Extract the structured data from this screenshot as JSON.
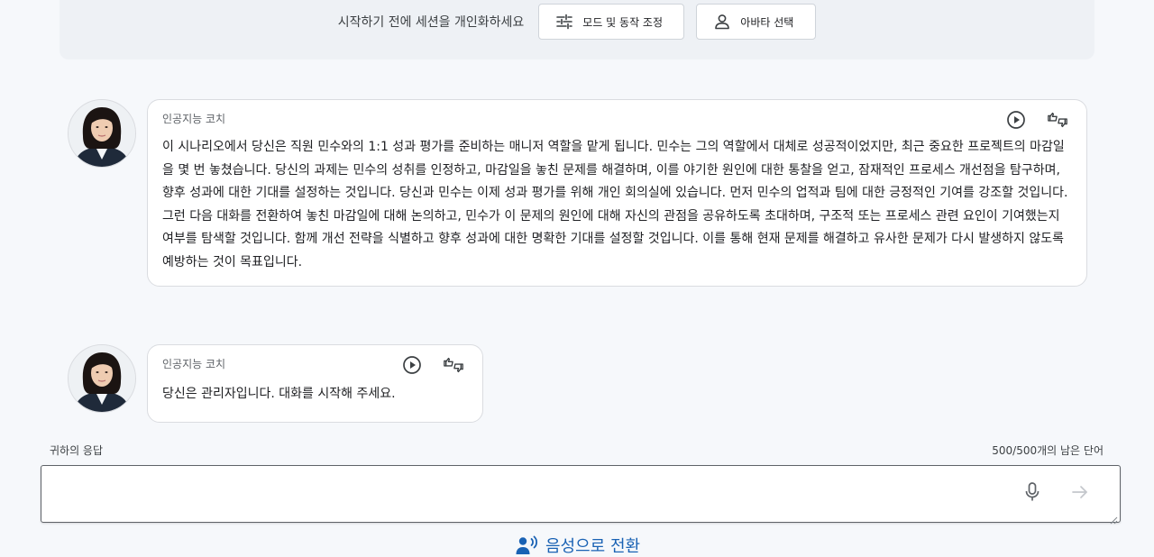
{
  "personalize": {
    "prompt": "시작하기 전에 세션을 개인화하세요",
    "mode_button": "모드 및 동작 조정",
    "avatar_button": "아바타 선택"
  },
  "messages": [
    {
      "sender": "인공지능 코치",
      "text": "이 시나리오에서 당신은 직원 민수와의 1:1 성과 평가를 준비하는 매니저 역할을 맡게 됩니다. 민수는 그의 역할에서 대체로 성공적이었지만, 최근 중요한 프로젝트의 마감일을 몇 번 놓쳤습니다. 당신의 과제는 민수의 성취를 인정하고, 마감일을 놓친 문제를 해결하며, 이를 야기한 원인에 대한 통찰을 얻고, 잠재적인 프로세스 개선점을 탐구하며, 향후 성과에 대한 기대를 설정하는 것입니다. 당신과 민수는 이제 성과 평가를 위해 개인 회의실에 있습니다. 먼저 민수의 업적과 팀에 대한 긍정적인 기여를 강조할 것입니다. 그런 다음 대화를 전환하여 놓친 마감일에 대해 논의하고, 민수가 이 문제의 원인에 대해 자신의 관점을 공유하도록 초대하며, 구조적 또는 프로세스 관련 요인이 기여했는지 여부를 탐색할 것입니다. 함께 개선 전략을 식별하고 향후 성과에 대한 명확한 기대를 설정할 것입니다. 이를 통해 현재 문제를 해결하고 유사한 문제가 다시 발생하지 않도록 예방하는 것이 목표입니다."
    },
    {
      "sender": "인공지능 코치",
      "text": "당신은 관리자입니다. 대화를 시작해 주세요."
    }
  ],
  "response": {
    "label": "귀하의 응답",
    "word_count": "500/500개의 남은 단어",
    "value": ""
  },
  "voice_switch": {
    "label": "음성으로 전환"
  },
  "icons": {
    "mode": "sliders-icon",
    "avatar": "person-icon",
    "play": "play-circle-icon",
    "feedback": "thumbs-up-down-icon",
    "mic": "microphone-icon",
    "send": "arrow-right-icon",
    "voice": "voice-person-icon"
  },
  "colors": {
    "accent": "#1a62b4",
    "background": "#f6f8fb"
  }
}
